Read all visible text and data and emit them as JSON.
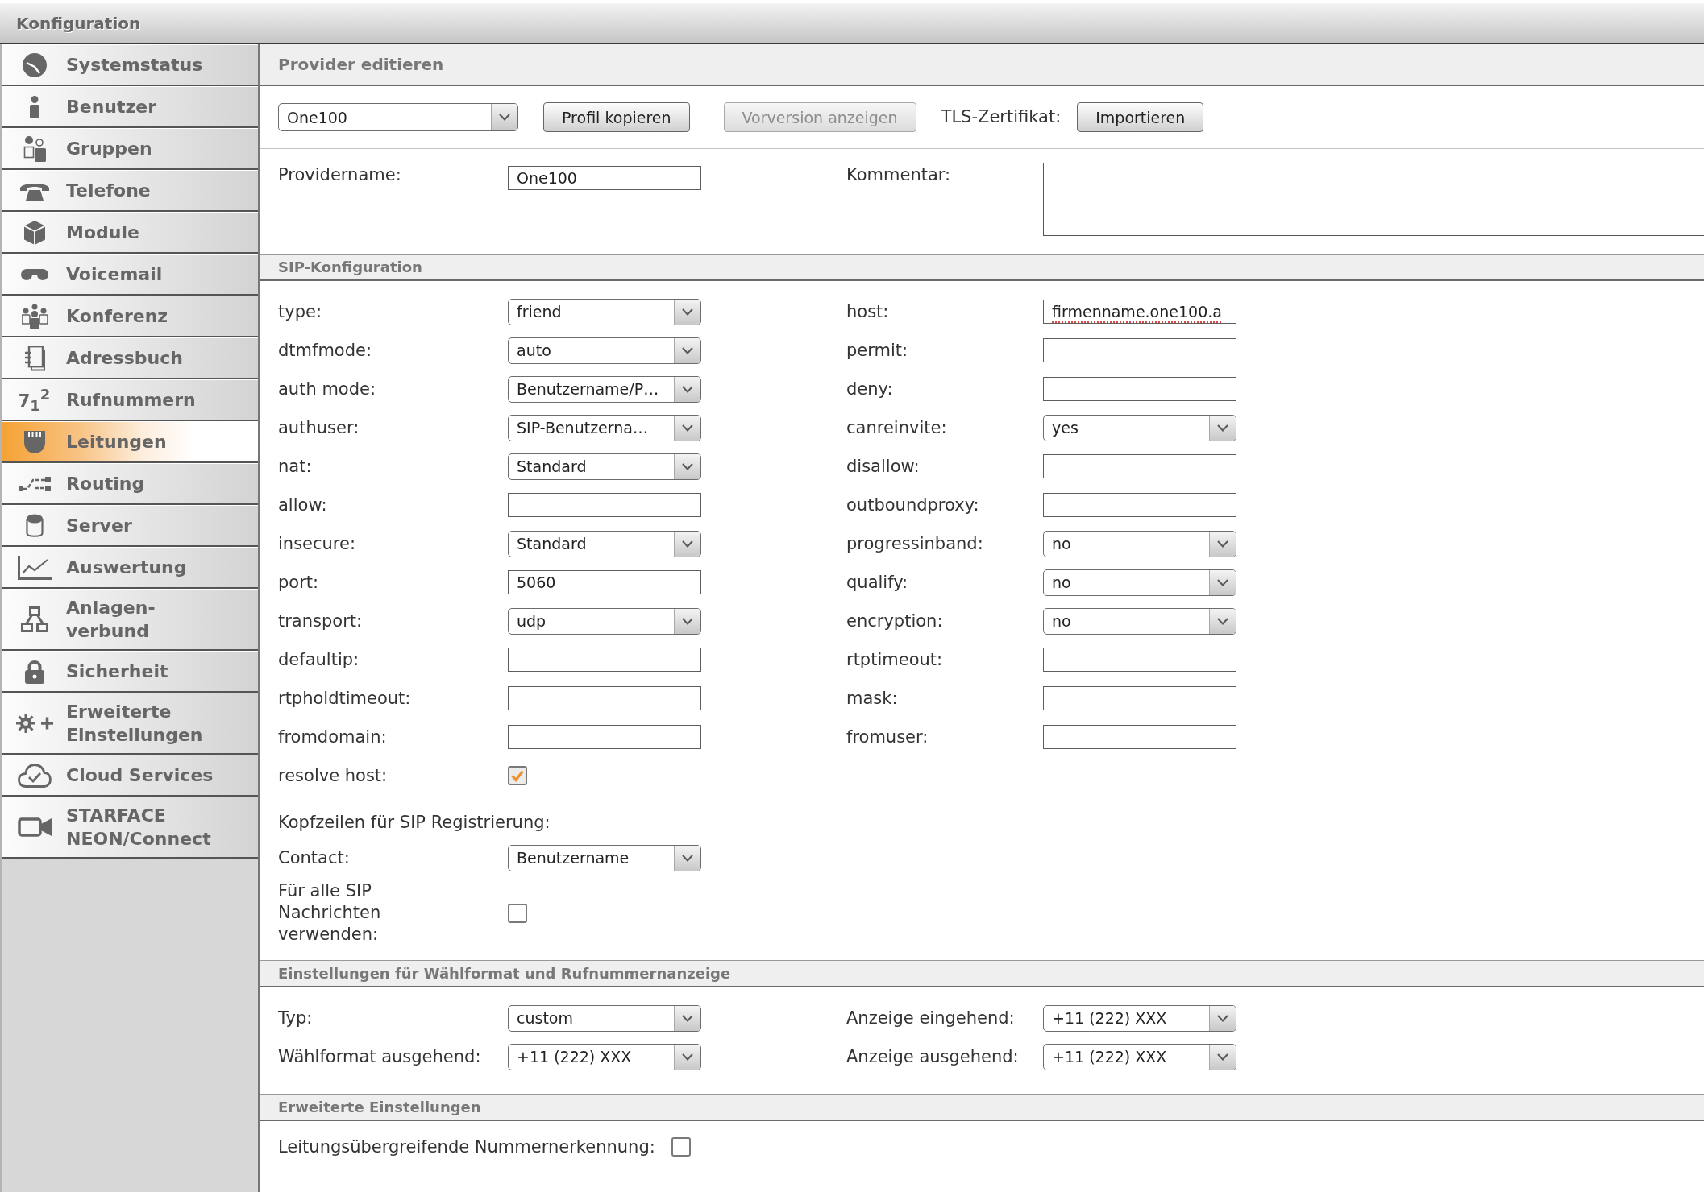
{
  "window": {
    "title": "Konfiguration"
  },
  "sidebar": {
    "items": [
      {
        "label": "Systemstatus",
        "selected": false
      },
      {
        "label": "Benutzer",
        "selected": false
      },
      {
        "label": "Gruppen",
        "selected": false
      },
      {
        "label": "Telefone",
        "selected": false
      },
      {
        "label": "Module",
        "selected": false
      },
      {
        "label": "Voicemail",
        "selected": false
      },
      {
        "label": "Konferenz",
        "selected": false
      },
      {
        "label": "Adressbuch",
        "selected": false
      },
      {
        "label": "Rufnummern",
        "selected": false,
        "glyph": "7$_{1}$$^{2}$"
      },
      {
        "label": "Leitungen",
        "selected": true
      },
      {
        "label": "Routing",
        "selected": false
      },
      {
        "label": "Server",
        "selected": false
      },
      {
        "label": "Auswertung",
        "selected": false
      },
      {
        "label": "Anlagen-\nverbund",
        "selected": false
      },
      {
        "label": "Sicherheit",
        "selected": false
      },
      {
        "label": "Erweiterte Einstellungen",
        "selected": false
      },
      {
        "label": "Cloud Services",
        "selected": false
      },
      {
        "label": "STARFACE NEON/Connect",
        "selected": false
      }
    ]
  },
  "page": {
    "title": "Provider editieren"
  },
  "toolbar": [
    {
      "kind": "select",
      "value": "One100"
    },
    {
      "kind": "button",
      "label": "Profil kopieren",
      "disabled": false
    },
    {
      "kind": "button",
      "label": "Vorversion anzeigen",
      "disabled": true
    },
    {
      "kind": "label",
      "text": "TLS-Zertifikat:"
    },
    {
      "kind": "button",
      "label": "Importieren",
      "disabled": false
    }
  ],
  "provider": {
    "name": {
      "label": "Providername:",
      "value": "One100"
    },
    "comment": {
      "label": "Kommentar:"
    }
  },
  "sections": [
    {
      "title": "SIP-Konfiguration",
      "kind": "columns",
      "left": [
        {
          "label": "type:",
          "kind": "select",
          "value": "friend"
        },
        {
          "label": "dtmfmode:",
          "kind": "select",
          "value": "auto"
        },
        {
          "label": "auth mode:",
          "kind": "select",
          "value": "Benutzername/P…"
        },
        {
          "label": "authuser:",
          "kind": "select",
          "value": "SIP-Benutzerna…"
        },
        {
          "label": "nat:",
          "kind": "select",
          "value": "Standard"
        },
        {
          "label": "allow:",
          "kind": "input"
        },
        {
          "label": "insecure:",
          "kind": "select",
          "value": "Standard"
        },
        {
          "label": "port:",
          "kind": "input",
          "value": "5060"
        },
        {
          "label": "transport:",
          "kind": "select",
          "value": "udp"
        },
        {
          "label": "defaultip:",
          "kind": "input"
        },
        {
          "label": "rtpholdtimeout:",
          "kind": "input"
        },
        {
          "label": "fromdomain:",
          "kind": "input"
        },
        {
          "label": "resolve host:",
          "kind": "checkbox",
          "checked": true
        }
      ],
      "right": [
        {
          "label": "host:",
          "kind": "input",
          "value": "firmenname.one100.a",
          "spell_error": true
        },
        {
          "label": "permit:",
          "kind": "input"
        },
        {
          "label": "deny:",
          "kind": "input"
        },
        {
          "label": "canreinvite:",
          "kind": "select",
          "value": "yes"
        },
        {
          "label": "disallow:",
          "kind": "input"
        },
        {
          "label": "outboundproxy:",
          "kind": "input"
        },
        {
          "label": "progressinband:",
          "kind": "select",
          "value": "no"
        },
        {
          "label": "qualify:",
          "kind": "select",
          "value": "no"
        },
        {
          "label": "encryption:",
          "kind": "select",
          "value": "no"
        },
        {
          "label": "rtptimeout:",
          "kind": "input"
        },
        {
          "label": "mask:",
          "kind": "input"
        },
        {
          "label": "fromuser:",
          "kind": "input"
        }
      ],
      "subheading": "Kopfzeilen für SIP Registrierung:",
      "extra": [
        {
          "label": "Contact:",
          "kind": "select",
          "value": "Benutzername"
        },
        {
          "label": "Für alle SIP Nachrichten verwenden:",
          "kind": "checkbox",
          "checked": false
        }
      ]
    },
    {
      "title": "Einstellungen für Wählformat und Rufnummernanzeige",
      "kind": "columns",
      "left": [
        {
          "label": "Typ:",
          "kind": "select",
          "value": "custom"
        },
        {
          "label": "Wählformat ausgehend:",
          "kind": "select",
          "value": "+11 (222) XXX"
        }
      ],
      "right": [
        {
          "label": "Anzeige eingehend:",
          "kind": "select",
          "value": "+11 (222) XXX"
        },
        {
          "label": "Anzeige ausgehend:",
          "kind": "select",
          "value": "+11 (222) XXX"
        }
      ]
    },
    {
      "title": "Erweiterte Einstellungen",
      "kind": "inline",
      "rows": [
        {
          "label": "Leitungsübergreifende Nummernerkennung:",
          "kind": "checkbox",
          "checked": false
        }
      ]
    }
  ]
}
